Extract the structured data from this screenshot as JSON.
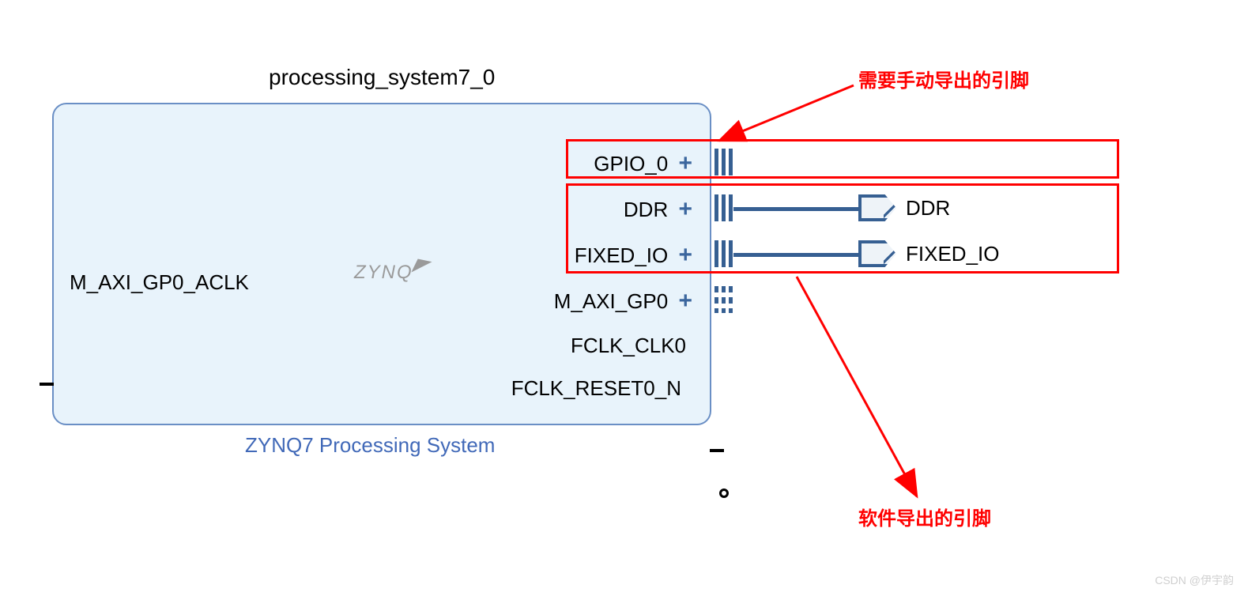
{
  "block": {
    "instance_name": "processing_system7_0",
    "subtitle": "ZYNQ7 Processing System",
    "logo_text": "ZYNQ",
    "ports_left": [
      {
        "name": "M_AXI_GP0_ACLK"
      }
    ],
    "ports_right": [
      {
        "name": "GPIO_0",
        "expandable": true,
        "bus_solid": true
      },
      {
        "name": "DDR",
        "expandable": true,
        "bus_solid": true,
        "external": "DDR"
      },
      {
        "name": "FIXED_IO",
        "expandable": true,
        "bus_solid": true,
        "external": "FIXED_IO"
      },
      {
        "name": "M_AXI_GP0",
        "expandable": true,
        "bus_dashed": true
      },
      {
        "name": "FCLK_CLK0",
        "expandable": false
      },
      {
        "name": "FCLK_RESET0_N",
        "expandable": false,
        "negated": true
      }
    ]
  },
  "annotations": {
    "manual_export": "需要手动导出的引脚",
    "software_export": "软件导出的引脚"
  },
  "external_ports": [
    {
      "label": "DDR"
    },
    {
      "label": "FIXED_IO"
    }
  ],
  "watermark": "CSDN @伊宇韵",
  "colors": {
    "block_fill": "#e8f3fb",
    "block_stroke": "#6a8fc5",
    "bus": "#365f92",
    "annotation": "#ff0000"
  }
}
